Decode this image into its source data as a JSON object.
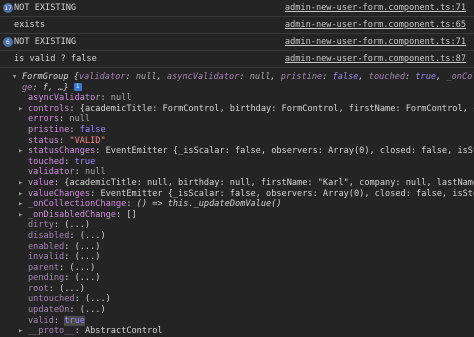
{
  "log_rows": [
    {
      "badge": "17",
      "text": "NOT EXISTING",
      "source": "admin-new-user-form.component.ts:71"
    },
    {
      "badge": "",
      "text": "exists",
      "source": "admin-new-user-form.component.ts:65"
    },
    {
      "badge": "6",
      "text": "NOT EXISTING",
      "source": "admin-new-user-form.component.ts:71"
    },
    {
      "badge": "",
      "text": "is valid ? false",
      "source": "admin-new-user-form.component.ts:87"
    }
  ],
  "form_group": {
    "header_l1_prefix": "FormGroup {",
    "header_l1_k1": "validator",
    "header_l1_v1": "null",
    "header_l1_k2": "asyncValidator",
    "header_l1_v2": "null",
    "header_l1_k3": "pristine",
    "header_l1_v3": "false",
    "header_l1_k4": "touched",
    "header_l1_v4": "true",
    "header_l1_tail": "_onCollectionChange",
    "header_l2_key": "ge",
    "header_l2_val": "f, …}",
    "lines": [
      {
        "key": "asyncValidator",
        "val": "null"
      },
      {
        "key": "controls",
        "val": "{academicTitle: FormControl, birthday: FormControl, firstName: FormControl, company: For"
      },
      {
        "key": "errors",
        "val": "null"
      },
      {
        "key": "pristine",
        "val": "false"
      },
      {
        "key": "status",
        "val": "\"VALID\""
      },
      {
        "key": "statusChanges",
        "val": "EventEmitter {_isScalar: false, observers: Array(0), closed: false, isStopped: fal"
      },
      {
        "key": "touched",
        "val": "true"
      },
      {
        "key": "validator",
        "val": "null"
      },
      {
        "key": "value",
        "val": "{academicTitle: null, birthday: null, firstName: \"Karl\", company: null, lastName: \"Matt\","
      },
      {
        "key": "valueChanges",
        "val": "EventEmitter {_isScalar: false, observers: Array(0), closed: false, isStopped: fals"
      },
      {
        "key": "_onCollectionChange",
        "val": "() => this._updateDomValue()"
      },
      {
        "key": "_onDisabledChange",
        "val": "[]"
      },
      {
        "key": "dirty",
        "val": "(...)"
      },
      {
        "key": "disabled",
        "val": "(...)"
      },
      {
        "key": "enabled",
        "val": "(...)"
      },
      {
        "key": "invalid",
        "val": "(...)"
      },
      {
        "key": "parent",
        "val": "(...)"
      },
      {
        "key": "pending",
        "val": "(...)"
      },
      {
        "key": "root",
        "val": "(...)"
      },
      {
        "key": "untouched",
        "val": "(...)"
      },
      {
        "key": "updateOn",
        "val": "(...)"
      },
      {
        "key": "valid",
        "val": "true"
      },
      {
        "key": "__proto__",
        "val": "AbstractControl"
      }
    ]
  }
}
